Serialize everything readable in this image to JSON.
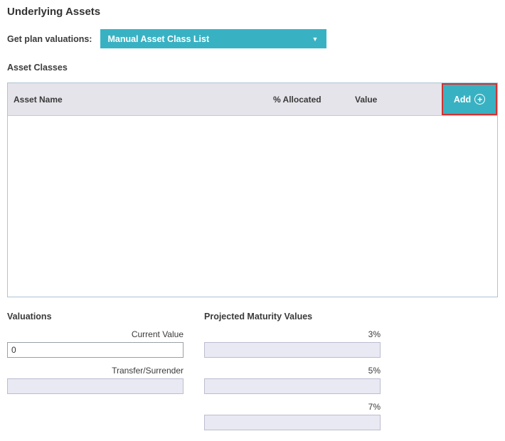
{
  "page": {
    "title": "Underlying Assets"
  },
  "plan_valuations": {
    "label": "Get plan valuations:",
    "selected": "Manual Asset Class List",
    "chevron_icon": "▼"
  },
  "asset_classes": {
    "label": "Asset Classes",
    "table": {
      "columns": [
        "Asset Name",
        "% Allocated",
        "Value"
      ],
      "add_label": "Add",
      "add_icon": "+",
      "rows": []
    }
  },
  "valuations": {
    "heading": "Valuations",
    "fields": [
      {
        "label": "Current Value",
        "value": "0",
        "editable": true
      },
      {
        "label": "Transfer/Surrender",
        "value": "",
        "editable": false
      }
    ]
  },
  "projected_maturity": {
    "heading": "Projected Maturity Values",
    "fields": [
      {
        "label": "3%",
        "value": ""
      },
      {
        "label": "5%",
        "value": ""
      },
      {
        "label": "7%",
        "value": ""
      }
    ]
  },
  "colors": {
    "accent_teal": "#38b2c3",
    "annotation_red": "#d23131",
    "table_header_bg": "#e4e4ea",
    "table_border": "#aec3d2",
    "disabled_input_bg": "#e9e9f4"
  }
}
